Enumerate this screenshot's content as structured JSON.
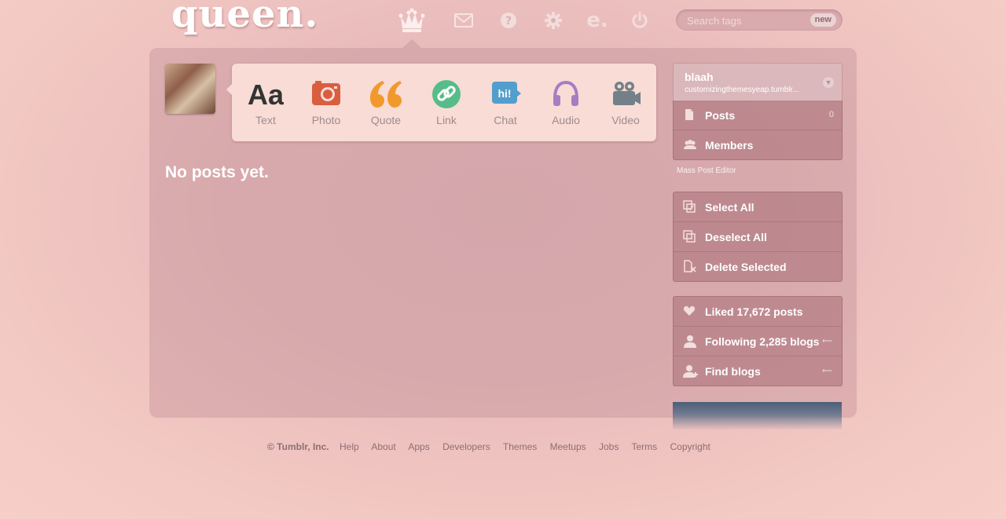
{
  "brand": {
    "logo": "queen."
  },
  "nav": {
    "items": [
      {
        "name": "dashboard",
        "icon": "crown-icon"
      },
      {
        "name": "messages",
        "icon": "envelope-icon"
      },
      {
        "name": "help",
        "icon": "question-icon"
      },
      {
        "name": "settings",
        "icon": "gear-icon"
      },
      {
        "name": "edit",
        "icon": "e-icon"
      },
      {
        "name": "logout",
        "icon": "power-icon"
      }
    ]
  },
  "search": {
    "placeholder": "Search tags",
    "badge": "new"
  },
  "post_types": [
    {
      "label": "Text",
      "icon": "text-icon",
      "color": "#333333"
    },
    {
      "label": "Photo",
      "icon": "camera-icon",
      "color": "#d95e40"
    },
    {
      "label": "Quote",
      "icon": "quote-icon",
      "color": "#f2992e"
    },
    {
      "label": "Link",
      "icon": "link-icon",
      "color": "#56bc8a"
    },
    {
      "label": "Chat",
      "icon": "chat-icon",
      "color": "#529ecc"
    },
    {
      "label": "Audio",
      "icon": "headphones-icon",
      "color": "#a77dc2"
    },
    {
      "label": "Video",
      "icon": "video-camera-icon",
      "color": "#748089"
    }
  ],
  "main": {
    "empty_message": "No posts yet."
  },
  "sidebar": {
    "blog_name": "blaah",
    "blog_url": "customizingthemesyeap.tumblr...",
    "blog_items": [
      {
        "label": "Posts",
        "count": "0",
        "icon": "document-icon"
      },
      {
        "label": "Members",
        "count": "",
        "icon": "members-icon"
      }
    ],
    "mass_editor_title": "Mass Post Editor",
    "mass_items": [
      {
        "label": "Select All",
        "icon": "select-all-icon"
      },
      {
        "label": "Deselect All",
        "icon": "deselect-all-icon"
      },
      {
        "label": "Delete Selected",
        "icon": "delete-icon"
      }
    ],
    "user_items": [
      {
        "label": "Liked 17,672 posts",
        "icon": "heart-icon"
      },
      {
        "label": "Following 2,285 blogs",
        "icon": "person-icon"
      },
      {
        "label": "Find blogs",
        "icon": "add-person-icon"
      }
    ]
  },
  "footer": {
    "copyright": "© Tumblr, Inc.",
    "links": [
      "Help",
      "About",
      "Apps",
      "Developers",
      "Themes",
      "Meetups",
      "Jobs",
      "Terms",
      "Copyright"
    ]
  }
}
